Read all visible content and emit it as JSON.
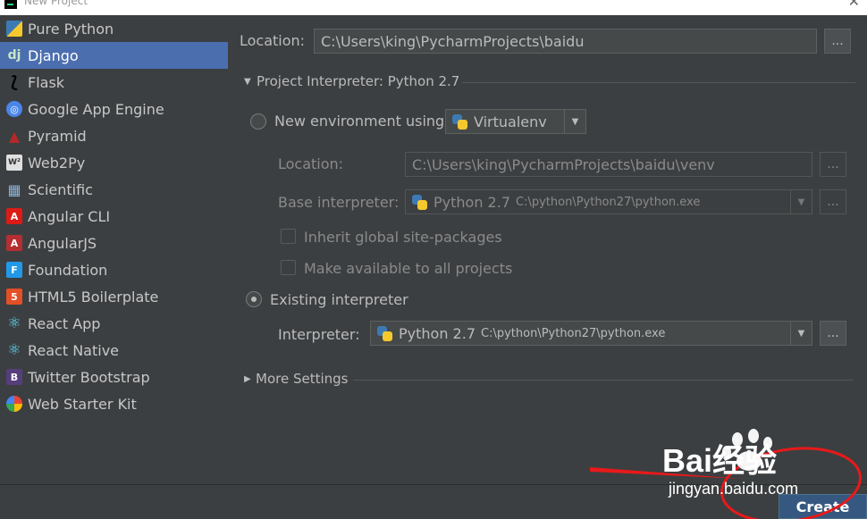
{
  "window": {
    "title": "New Project"
  },
  "sidebar": {
    "items": [
      {
        "label": "Pure Python",
        "icon": "python-icon",
        "selected": false
      },
      {
        "label": "Django",
        "icon": "django-icon",
        "selected": true
      },
      {
        "label": "Flask",
        "icon": "flask-icon",
        "selected": false
      },
      {
        "label": "Google App Engine",
        "icon": "google-app-engine-icon",
        "selected": false
      },
      {
        "label": "Pyramid",
        "icon": "pyramid-icon",
        "selected": false
      },
      {
        "label": "Web2Py",
        "icon": "web2py-icon",
        "selected": false
      },
      {
        "label": "Scientific",
        "icon": "scientific-grid-icon",
        "selected": false
      },
      {
        "label": "Angular CLI",
        "icon": "angular-cli-icon",
        "selected": false
      },
      {
        "label": "AngularJS",
        "icon": "angularjs-icon",
        "selected": false
      },
      {
        "label": "Foundation",
        "icon": "foundation-icon",
        "selected": false
      },
      {
        "label": "HTML5 Boilerplate",
        "icon": "html5-icon",
        "selected": false
      },
      {
        "label": "React App",
        "icon": "react-icon",
        "selected": false
      },
      {
        "label": "React Native",
        "icon": "react-icon",
        "selected": false
      },
      {
        "label": "Twitter Bootstrap",
        "icon": "bootstrap-icon",
        "selected": false
      },
      {
        "label": "Web Starter Kit",
        "icon": "web-starter-kit-icon",
        "selected": false
      }
    ]
  },
  "main": {
    "location_label": "Location:",
    "location_value": "C:\\Users\\king\\PycharmProjects\\baidu",
    "browse_label": "...",
    "interpreter_section": "Project Interpreter: Python 2.7",
    "new_env_label": "New environment using",
    "new_env_tool": "Virtualenv",
    "venv_location_label": "Location:",
    "venv_location_value": "C:\\Users\\king\\PycharmProjects\\baidu\\venv",
    "base_interpreter_label": "Base interpreter:",
    "base_interpreter_name": "Python 2.7",
    "base_interpreter_path": "C:\\python\\Python27\\python.exe",
    "inherit_label": "Inherit global site-packages",
    "make_available_label": "Make available to all projects",
    "existing_label": "Existing interpreter",
    "interpreter_label": "Interpreter:",
    "interpreter_name": "Python 2.7",
    "interpreter_path": "C:\\python\\Python27\\python.exe",
    "more_settings_label": "More Settings"
  },
  "footer": {
    "create_label": "Create"
  },
  "watermark": {
    "brand": "Bai经验",
    "url": "jingyan.baidu.com"
  },
  "colors": {
    "selection": "#4b6eaf",
    "background": "#3c3f41",
    "annotation": "#e8191a"
  }
}
